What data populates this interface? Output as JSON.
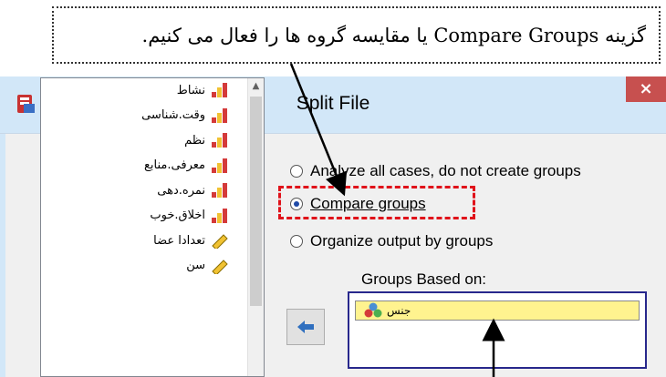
{
  "callout": {
    "text": "گزینه Compare Groups  یا مقایسه گروه ها را فعال می کنیم."
  },
  "dialog": {
    "title": "Split File",
    "close_label": "×"
  },
  "variables": [
    {
      "label": "نشاط",
      "kind": "ordinal"
    },
    {
      "label": "وقت.شناسی",
      "kind": "ordinal"
    },
    {
      "label": "نظم",
      "kind": "ordinal"
    },
    {
      "label": "معرفی.منابع",
      "kind": "ordinal"
    },
    {
      "label": "نمره.دهی",
      "kind": "ordinal"
    },
    {
      "label": "اخلاق.خوب",
      "kind": "ordinal"
    },
    {
      "label": "تعدادا عضا",
      "kind": "scale"
    },
    {
      "label": "سن",
      "kind": "scale"
    }
  ],
  "options": {
    "analyze_all": {
      "label": "Analyze all cases, do not create groups",
      "selected": false
    },
    "compare": {
      "label": "Compare groups",
      "selected": true
    },
    "organize": {
      "label": "Organize output by groups",
      "selected": false
    }
  },
  "groups": {
    "label": "Groups Based on:",
    "items": [
      {
        "label": "جنس",
        "kind": "nominal"
      }
    ]
  },
  "colors": {
    "titlebar": "#d2e7f8",
    "close": "#c7504f",
    "highlight": "#e0121a",
    "selected_item": "#fff38f"
  }
}
